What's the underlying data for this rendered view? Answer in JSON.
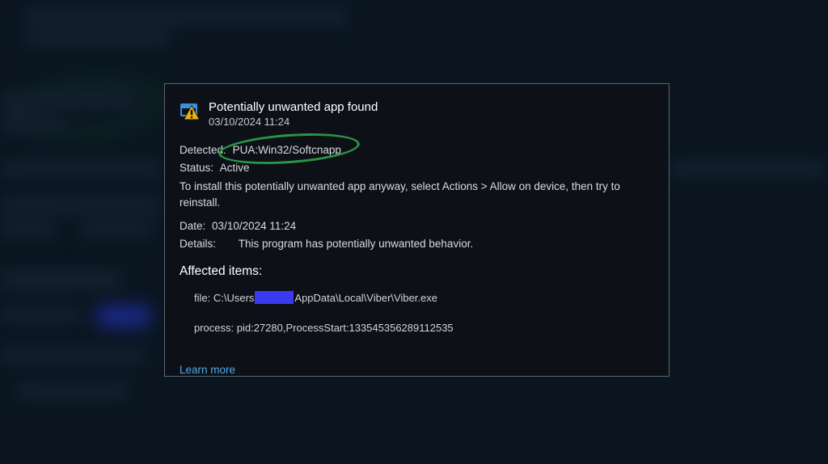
{
  "dialog": {
    "title": "Potentially unwanted app found",
    "timestamp": "03/10/2024 11:24",
    "detected_label": "Detected:",
    "detected_value": "PUA:Win32/Softcnapp",
    "status_label": "Status:",
    "status_value": "Active",
    "hint": "To install this potentially unwanted app anyway, select Actions > Allow on device, then try to reinstall.",
    "date_label": "Date:",
    "date_value": "03/10/2024 11:24",
    "details_label": "Details:",
    "details_value": "This program has potentially unwanted behavior.",
    "affected_heading": "Affected items:",
    "file_prefix": "file: C:\\Users",
    "file_suffix": "AppData\\Local\\Viber\\Viber.exe",
    "process_line": "process: pid:27280,ProcessStart:133545356289112535",
    "learn_more": "Learn more"
  }
}
